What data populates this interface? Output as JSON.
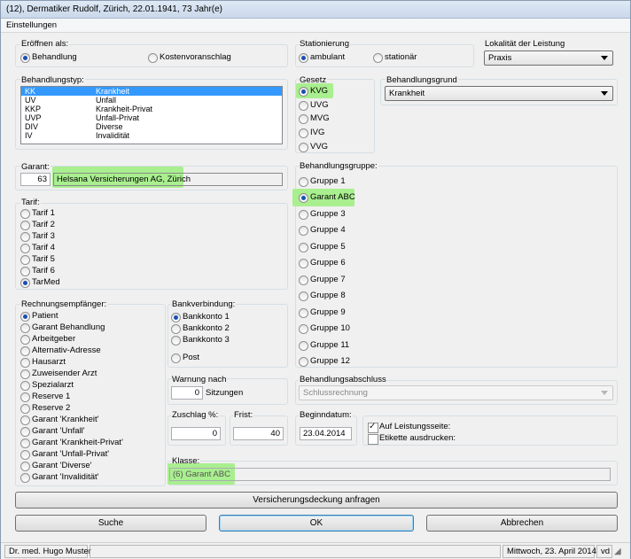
{
  "window": {
    "title": "(12), Dermatiker Rudolf, Zürich, 22.01.1941, 73 Jahr(e)"
  },
  "menu": {
    "einstellungen": "Einstellungen"
  },
  "eroeffnen": {
    "label": "Eröffnen als:",
    "options": [
      "Behandlung",
      "Kostenvoranschlag"
    ],
    "selected": "Behandlung"
  },
  "stationierung": {
    "label": "Stationierung",
    "options": [
      "ambulant",
      "stationär"
    ],
    "selected": "ambulant"
  },
  "lokalitaet": {
    "label": "Lokalität der Leistung",
    "value": "Praxis"
  },
  "behandlungstyp": {
    "label": "Behandlungstyp:",
    "rows": [
      {
        "code": "KK",
        "name": "Krankheit",
        "selected": true
      },
      {
        "code": "UV",
        "name": "Unfall"
      },
      {
        "code": "KKP",
        "name": "Krankheit-Privat"
      },
      {
        "code": "UVP",
        "name": "Unfall-Privat"
      },
      {
        "code": "DIV",
        "name": "Diverse"
      },
      {
        "code": "IV",
        "name": "Invalidität"
      }
    ]
  },
  "gesetz": {
    "label": "Gesetz",
    "options": [
      "KVG",
      "UVG",
      "MVG",
      "IVG",
      "VVG"
    ],
    "selected": "KVG"
  },
  "behandlungsgrund": {
    "label": "Behandlungsgrund",
    "value": "Krankheit"
  },
  "garant": {
    "label": "Garant:",
    "number": "63",
    "name": "Helsana Versicherungen AG, Zürich"
  },
  "tarif": {
    "label": "Tarif:",
    "options": [
      "Tarif 1",
      "Tarif 2",
      "Tarif 3",
      "Tarif 4",
      "Tarif 5",
      "Tarif 6",
      "TarMed"
    ],
    "selected": "TarMed"
  },
  "behandlungsgruppe": {
    "label": "Behandlungsgruppe:",
    "options": [
      "Gruppe 1",
      "Garant ABC",
      "Gruppe 3",
      "Gruppe 4",
      "Gruppe 5",
      "Gruppe 6",
      "Gruppe 7",
      "Gruppe 8",
      "Gruppe 9",
      "Gruppe 10",
      "Gruppe 11",
      "Gruppe 12"
    ],
    "selected": "Garant ABC"
  },
  "rechnungsempfaenger": {
    "label": "Rechnungsempfänger:",
    "options": [
      "Patient",
      "Garant Behandlung",
      "Arbeitgeber",
      "Alternativ-Adresse",
      "Hausarzt",
      "Zuweisender Arzt",
      "Spezialarzt",
      "Reserve 1",
      "Reserve 2",
      "Garant 'Krankheit'",
      "Garant 'Unfall'",
      "Garant 'Krankheit-Privat'",
      "Garant 'Unfall-Privat'",
      "Garant 'Diverse'",
      "Garant 'Invalidität'"
    ],
    "selected": "Patient"
  },
  "bankverbindung": {
    "label": "Bankverbindung:",
    "options": [
      "Bankkonto 1",
      "Bankkonto 2",
      "Bankkonto 3"
    ],
    "post": "Post",
    "selected": "Bankkonto 1"
  },
  "warnung": {
    "label": "Warnung nach",
    "value": "0",
    "unit": "Sitzungen"
  },
  "abschluss": {
    "label": "Behandlungsabschluss",
    "value": "Schlussrechnung"
  },
  "zuschlag": {
    "label": "Zuschlag %:",
    "value": "0"
  },
  "frist": {
    "label": "Frist:",
    "value": "40"
  },
  "beginndatum": {
    "label": "Beginndatum:",
    "value": "23.04.2014"
  },
  "leistungsseite": {
    "label": "Auf Leistungsseite:",
    "checked": true
  },
  "etikette": {
    "label": "Etikette ausdrucken:",
    "checked": false
  },
  "klasse": {
    "label": "Klasse:",
    "value": "(6) Garant ABC"
  },
  "buttons": {
    "versicherung": "Versicherungsdeckung anfragen",
    "suche": "Suche",
    "ok": "OK",
    "abbrechen": "Abbrechen"
  },
  "status": {
    "doctor": "Dr. med. Hugo Muster",
    "date": "Mittwoch, 23. April 2014",
    "user": "vd"
  },
  "colors": {
    "highlight": "#a9ef8f",
    "selection": "#3399ff"
  }
}
